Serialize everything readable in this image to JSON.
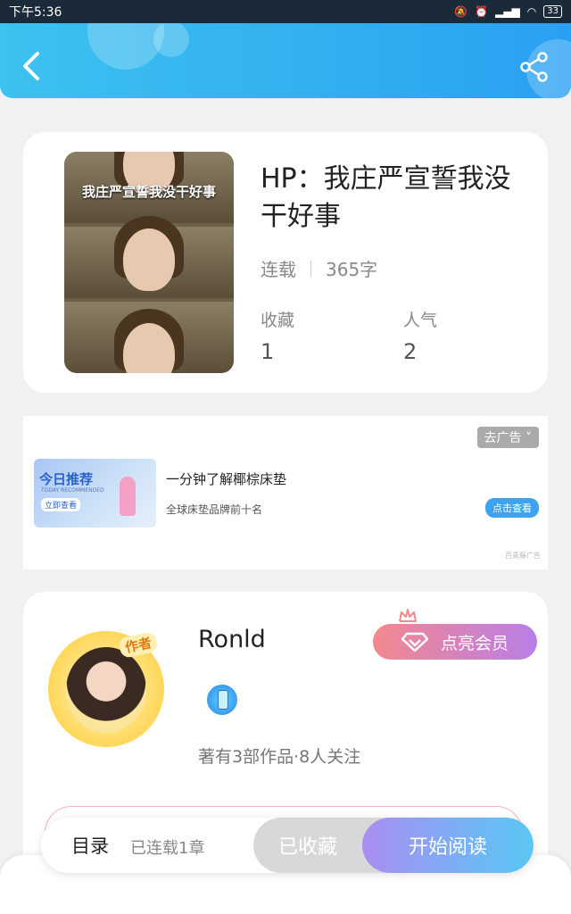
{
  "status_bar": {
    "time": "下午5:36",
    "battery": "33"
  },
  "book": {
    "cover_caption": "我庄严宣誓我没干好事",
    "title": "HP：我庄严宣誓我没干好事",
    "status": "连载",
    "word_count": "365字",
    "favorites_label": "收藏",
    "favorites_value": "1",
    "popularity_label": "人气",
    "popularity_value": "2"
  },
  "ad": {
    "close_label": "去广告 ˅",
    "image_title": "今日推荐",
    "image_subtitle": "TODAY RECOMMENDED",
    "image_button": "立即查看",
    "title": "一分钟了解椰棕床垫",
    "subtitle": "全球床垫品牌前十名",
    "cta": "点击查看",
    "source": "百青藤广告"
  },
  "author": {
    "tag": "作者",
    "name": "Ronld",
    "vip_label": "点亮会员",
    "stats": "著有3部作品·8人关注"
  },
  "bottom_bar": {
    "toc_label": "目录",
    "chapters": "已连载1章",
    "saved_label": "已收藏",
    "read_label": "开始阅读"
  },
  "colors": {
    "header": "#2aa0f2",
    "accent": "#3ea3ef",
    "vip": "#f4888f"
  }
}
